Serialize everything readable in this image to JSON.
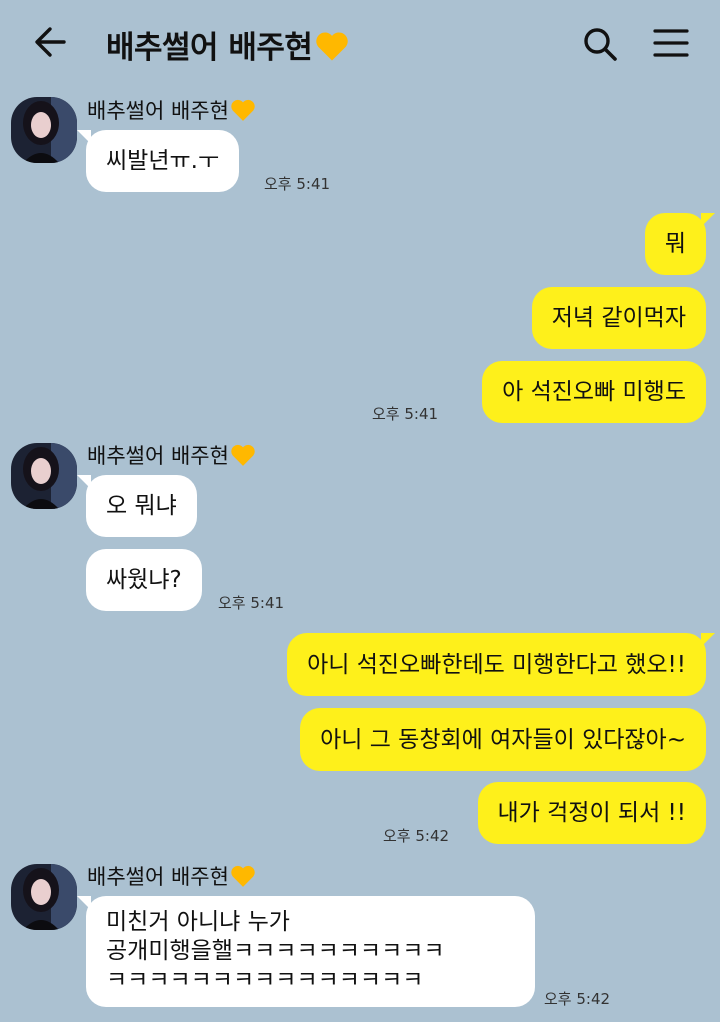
{
  "header": {
    "title": "배추썰어 배주현",
    "icons": [
      "back-arrow-icon",
      "search-icon",
      "menu-icon"
    ]
  },
  "colors": {
    "background": "#abc1d1",
    "outgoing": "#fef01b",
    "incoming": "#ffffff",
    "heart": "#ffb800"
  },
  "messages": [
    {
      "sender": "배추썰어 배주현",
      "text": "씨발년ㅠ.ㅜ",
      "time": "오후 5:41"
    },
    {
      "text": "뭐"
    },
    {
      "text": "저녁 같이먹자"
    },
    {
      "text": "아 석진오빠 미행도",
      "time": "오후 5:41"
    },
    {
      "sender": "배추썰어 배주현",
      "text": "오 뭐냐"
    },
    {
      "text": "싸웠냐?",
      "time": "오후 5:41"
    },
    {
      "text": "아니 석진오빠한테도 미행한다고 했오!!"
    },
    {
      "text": "아니 그 동창회에 여자들이 있다잖아~"
    },
    {
      "text": "내가 걱정이 되서 !!",
      "time": "오후 5:42"
    },
    {
      "sender": "배추썰어 배주현",
      "lines": [
        "미친거 아니냐 누가",
        "공개미행을핼ㅋㅋㅋㅋㅋㅋㅋㅋㅋㅋ",
        "ㅋㅋㅋㅋㅋㅋㅋㅋㅋㅋㅋㅋㅋㅋㅋ"
      ],
      "time": "오후 5:42"
    }
  ]
}
